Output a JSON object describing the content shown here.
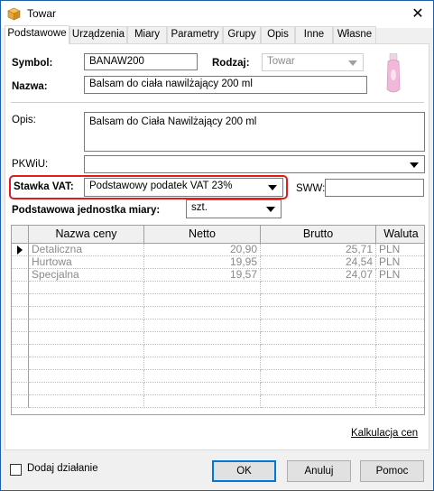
{
  "window": {
    "title": "Towar"
  },
  "tabs": [
    "Podstawowe",
    "Urządzenia",
    "Miary",
    "Parametry",
    "Grupy",
    "Opis",
    "Inne",
    "Własne"
  ],
  "form": {
    "symbol_label": "Symbol:",
    "symbol_value": "BANAW200",
    "rodzaj_label": "Rodzaj:",
    "rodzaj_value": "Towar",
    "nazwa_label": "Nazwa:",
    "nazwa_value": "Balsam do ciała nawilżający 200 ml",
    "opis_label": "Opis:",
    "opis_value": "Balsam do Ciała Nawilżający 200 ml",
    "pkwiu_label": "PKWiU:",
    "pkwiu_value": "",
    "vat_label": "Stawka VAT:",
    "vat_value": "Podstawowy podatek VAT 23%",
    "sww_label": "SWW:",
    "sww_value": "",
    "jm_label": "Podstawowa jednostka miary:",
    "jm_value": "szt."
  },
  "price_table": {
    "headers": [
      "Nazwa ceny",
      "Netto",
      "Brutto",
      "Waluta"
    ],
    "rows": [
      {
        "name": "Detaliczna",
        "netto": "20,90",
        "brutto": "25,71",
        "waluta": "PLN"
      },
      {
        "name": "Hurtowa",
        "netto": "19,95",
        "brutto": "24,54",
        "waluta": "PLN"
      },
      {
        "name": "Specjalna",
        "netto": "19,57",
        "brutto": "24,07",
        "waluta": "PLN"
      }
    ]
  },
  "kalkulacja_link": "Kalkulacja cen",
  "footer": {
    "dodaj_label": "Dodaj działanie",
    "ok": "OK",
    "anuluj": "Anuluj",
    "pomoc": "Pomoc"
  },
  "colors": {
    "highlight": "#e21b1b",
    "accent": "#0078d7",
    "product": "#f2b8d9"
  },
  "icons": {
    "app": "product-box-icon",
    "close": "close-icon",
    "product_image": "lotion-bottle-image"
  }
}
